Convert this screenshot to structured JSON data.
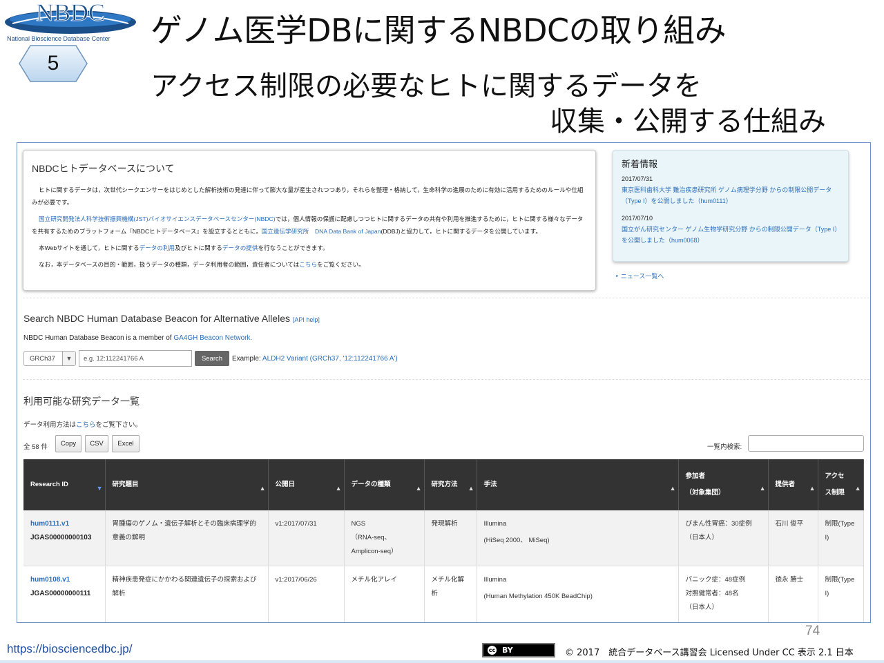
{
  "slide": {
    "logo_text": "NBDC",
    "logo_subtitle": "National Bioscience Database Center",
    "number": "5",
    "title": "ゲノム医学DBに関するNBDCの取り組み",
    "subtitle_line1": "アクセス制限の必要なヒトに関するデータを",
    "subtitle_line2": "収集・公開する仕組み",
    "page_number": "74",
    "footer_url": "https://biosciencedbc.jp/",
    "cc_label": "cc",
    "cc_by": "BY",
    "copyright": "© 2017　統合データベース講習会 Licensed Under CC 表示 2.1 日本"
  },
  "about": {
    "title": "NBDCヒトデータベースについて",
    "p1": "ヒトに関するデータは，次世代シークエンサーをはじめとした解析技術の発達に伴って膨大な量が産生されつつあり，それらを整理・格納して，生命科学の進展のために有効に活用するためのルールや仕組みが必要です。",
    "p2_link1": "国立研究開発法人科学技術振興機構(JST)バイオサイエンスデータベースセンター(NBDC)",
    "p2_text1": "では，個人情報の保護に配慮しつつヒトに関するデータの共有や利用を推進するために，ヒトに関する様々なデータを共有するためのプラットフォーム『NBDCヒトデータベース』を設立するとともに，",
    "p2_link2": "国立遺伝学研究所　DNA Data Bank of Japan",
    "p2_text2": "(DDBJ)と協力して，ヒトに関するデータを公開しています。",
    "p3_a": "本Webサイトを通して，ヒトに関する",
    "p3_link1": "データの利用",
    "p3_b": "及びヒトに関する",
    "p3_link2": "データの提供",
    "p3_c": "を行なうことができます。",
    "p4_a": "なお，本データベースの目的・範囲，扱うデータの種類，データ利用者の範囲，責任者については",
    "p4_link": "こちら",
    "p4_b": "をご覧ください。"
  },
  "news": {
    "title": "新着情報",
    "items": [
      {
        "date": "2017/07/31",
        "text": "東京医科歯科大学 難治疾患研究所 ゲノム病理学分野 からの制限公開データ（Type I）を公開しました（hum0111）"
      },
      {
        "date": "2017/07/10",
        "text": "国立がん研究センター ゲノム生物学研究分野 からの制限公開データ（Type I）を公開しました（hum0068）"
      }
    ],
    "more": "‣ ニュース一覧へ"
  },
  "beacon": {
    "title": "Search NBDC Human Database Beacon for Alternative Alleles",
    "api_help": "[API help]",
    "desc_prefix": "NBDC Human Database Beacon is a member of ",
    "desc_link": "GA4GH Beacon Network.",
    "assembly": "GRCh37",
    "placeholder": "e.g. 12:112241766 A",
    "search_label": "Search",
    "example_prefix": "Example: ",
    "example_link": "ALDH2 Variant (GRCh37, '12:112241766 A')"
  },
  "list": {
    "title": "利用可能な研究データ一覧",
    "usage_prefix": "データ利用方法は",
    "usage_link": "こちら",
    "usage_suffix": "をご覧下さい。",
    "count": "全 58 件",
    "buttons": [
      "Copy",
      "CSV",
      "Excel"
    ],
    "filter_label": "一覧内検索:",
    "columns": [
      "Research ID",
      "研究題目",
      "公開日",
      "データの種類",
      "研究方法",
      "手法",
      "参加者（対象集団）",
      "提供者",
      "アクセス制限"
    ],
    "col_participants_line1": "参加者",
    "col_participants_line2": "（対象集団）",
    "col_access_line1": "アクセ",
    "col_access_line2": "ス制限",
    "rows": [
      {
        "rid": "hum0111.v1",
        "jgas": "JGAS00000000103",
        "title": "胃腫瘍のゲノム・遺伝子解析とその臨床病理学的意義の解明",
        "date": "v1:2017/07/31",
        "dtype_line1": "NGS",
        "dtype_line2": "（RNA-seq、Amplicon-seq）",
        "method": "発現解析",
        "tech_line1": "Illumina",
        "tech_line2": "(HiSeq 2000、 MiSeq)",
        "part_line1": "びまん性胃癌：30症例",
        "part_line2": "（日本人）",
        "part_line3": "",
        "provider": "石川 俊平",
        "access": "制限(Type I)"
      },
      {
        "rid": "hum0108.v1",
        "jgas": "JGAS00000000111",
        "title": "精神疾患発症にかかわる関連遺伝子の探索および解析",
        "date": "v1:2017/06/26",
        "dtype_line1": "メチル化アレイ",
        "dtype_line2": "",
        "method": "メチル化解析",
        "tech_line1": "Illumina",
        "tech_line2": "(Human Methylation 450K BeadChip)",
        "part_line1": "パニック症：48症例",
        "part_line2": "対照健常者：48名",
        "part_line3": "（日本人）",
        "provider": "徳永 勝士",
        "access": "制限(Type I)"
      }
    ]
  }
}
